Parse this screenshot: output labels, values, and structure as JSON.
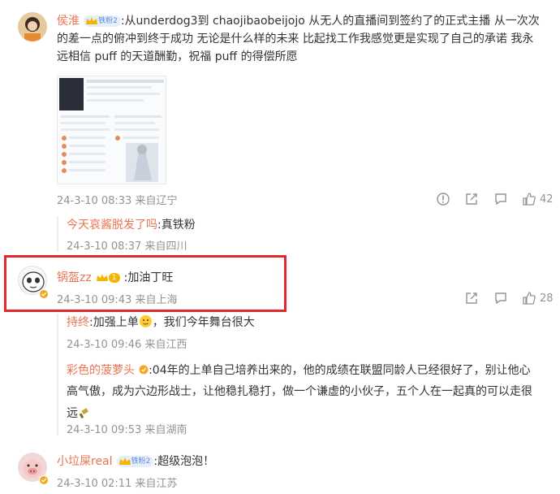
{
  "comments": [
    {
      "user": "侯淮",
      "fan_badge": "铁粉2",
      "text_line1": ":从underdog3到 chaojibaobeijojo 从无人的直播间到签约了的正式主播 从一次次",
      "text_line2": "的差一点的俯冲到终于成功 无论是什么样的未来 比起找工作我感觉更是实现了自己的承诺 我永",
      "text_line3": "远相信 puff 的天道酬勤，祝福 puff 的得偿所愿",
      "time": "24-3-10 08:33",
      "location": "来自辽宁",
      "likes": "42",
      "replies": [
        {
          "user": "今天哀酱脱发了吗",
          "text": ":真铁粉",
          "time": "24-3-10 08:37",
          "location": "来自四川"
        }
      ]
    },
    {
      "user": "锅盔zz",
      "level_badge": "1",
      "text": ":加油丁旺",
      "time": "24-3-10 09:43",
      "location": "来自上海",
      "likes": "28",
      "replies": [
        {
          "user": "持终",
          "text": ":加强上单",
          "text_tail": "，我们今年舞台很大",
          "time": "24-3-10 09:46",
          "location": "来自江西"
        },
        {
          "user": "彩色的菠萝头",
          "text_line1": ":04年的上单自己培养出来的，他的成绩在联盟同龄人已经很好了，别让他心",
          "text_line2": "高气傲，成为六边形战士，让他稳扎稳打，做一个谦虚的小伙子，五个人在一起真的可以走很",
          "text_line3": "远",
          "time": "24-3-10 09:53",
          "location": "来自湖南"
        }
      ]
    },
    {
      "user": "小垃屎real",
      "fan_badge": "铁粉2",
      "text": ":超级泡泡！",
      "time": "24-3-10 02:11",
      "location": "来自江苏"
    }
  ],
  "colors": {
    "name": "#eb7350",
    "meta": "#939393",
    "highlight": "#e6262d"
  }
}
